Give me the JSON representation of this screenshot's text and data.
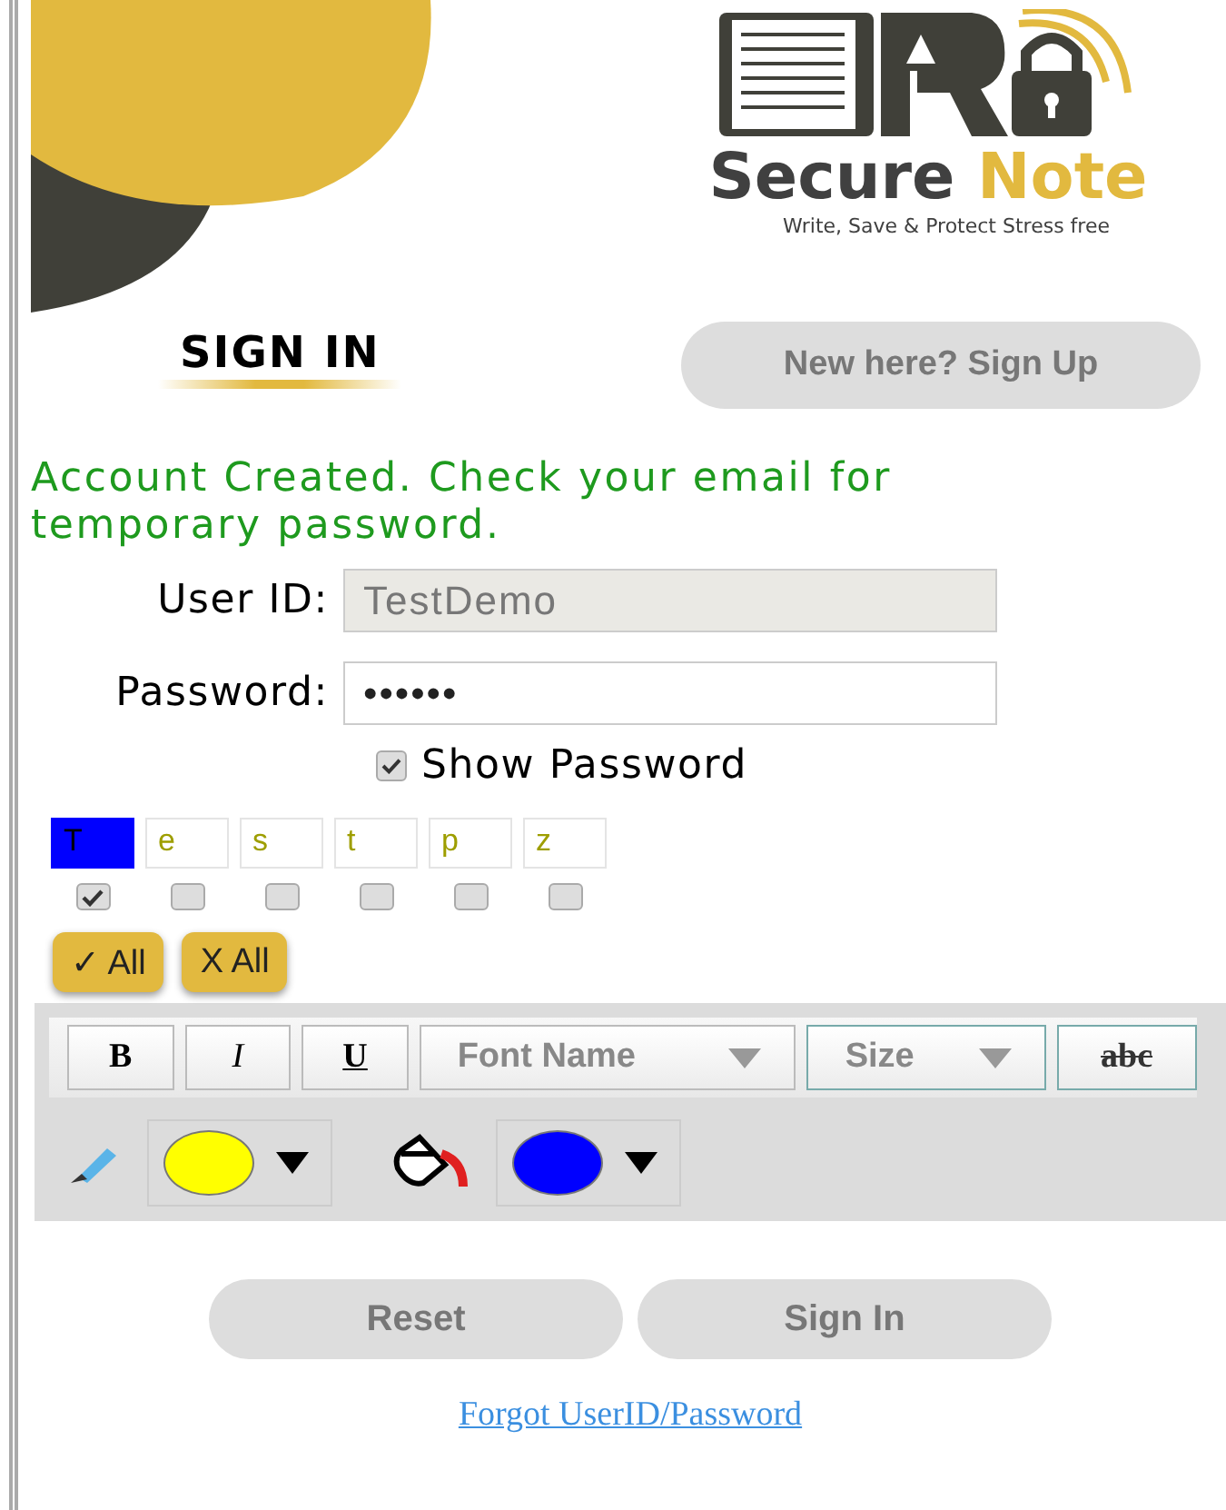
{
  "brand": {
    "name": "Secure",
    "accent": "Note",
    "tagline": "Write, Save & Protect Stress free"
  },
  "title": "SIGN IN",
  "signup_button": "New here? Sign Up",
  "message": "Account Created. Check your email for temporary password.",
  "fields": [
    {
      "label": "User ID:",
      "value": "TestDemo",
      "disabled": true
    },
    {
      "label": "Password:",
      "value": "••••••",
      "disabled": false
    }
  ],
  "show_password": {
    "label": "Show Password",
    "checked": true
  },
  "characters": [
    {
      "char": "T",
      "checked": true
    },
    {
      "char": "e",
      "checked": false
    },
    {
      "char": "s",
      "checked": false
    },
    {
      "char": "t",
      "checked": false
    },
    {
      "char": "p",
      "checked": false
    },
    {
      "char": "z",
      "checked": false
    }
  ],
  "select_buttons": [
    "✓ All",
    "X All"
  ],
  "format_buttons": [
    {
      "label": "B",
      "kind": "bold"
    },
    {
      "label": "I",
      "kind": "italic"
    },
    {
      "label": "U",
      "kind": "underline"
    }
  ],
  "font_select": "Font Name",
  "size_select": "Size",
  "strike_button": "abc",
  "pickers": [
    {
      "kind": "pen",
      "color": "#ffff00"
    },
    {
      "kind": "fill",
      "color": "#0000ff"
    }
  ],
  "buttons": [
    "Reset",
    "Sign In"
  ],
  "link": "Forgot UserID/Password"
}
